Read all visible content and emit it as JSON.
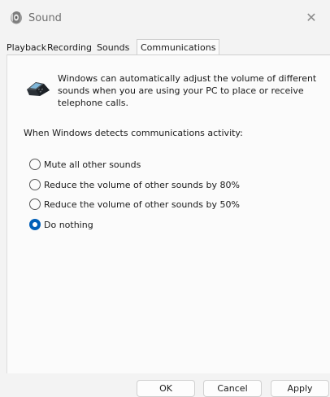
{
  "window": {
    "title": "Sound",
    "close_glyph": "✕"
  },
  "tabs": [
    {
      "label": "Playback",
      "active": false
    },
    {
      "label": "Recording",
      "active": false
    },
    {
      "label": "Sounds",
      "active": false
    },
    {
      "label": "Communications",
      "active": true
    }
  ],
  "communications": {
    "intro_text": "Windows can automatically adjust the volume of different sounds when you are using your PC to place or receive telephone calls.",
    "detect_label": "When Windows detects communications activity:",
    "options": [
      {
        "label": "Mute all other sounds",
        "selected": false
      },
      {
        "label": "Reduce the volume of other sounds by 80%",
        "selected": false
      },
      {
        "label": "Reduce the volume of other sounds by 50%",
        "selected": false
      },
      {
        "label": "Do nothing",
        "selected": true
      }
    ]
  },
  "buttons": {
    "ok": "OK",
    "cancel": "Cancel",
    "apply": "Apply"
  },
  "colors": {
    "accent": "#005fb8",
    "title_text": "#6f6f6f"
  }
}
